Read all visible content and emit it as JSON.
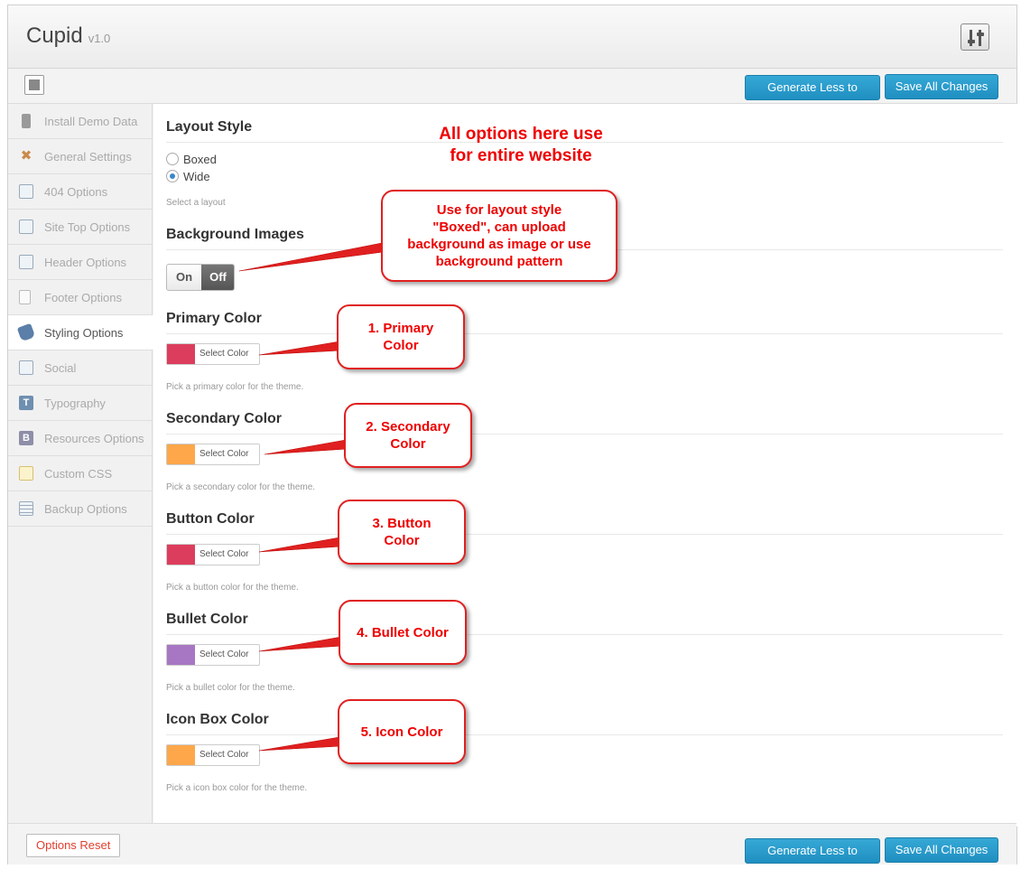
{
  "app": {
    "title": "Cupid",
    "version": "v1.0"
  },
  "toolbar": {
    "generate_label": "Generate Less to CSS",
    "save_label": "Save All Changes"
  },
  "sidebar": {
    "items": [
      {
        "label": "Install Demo Data",
        "icon": "install-icon"
      },
      {
        "label": "General Settings",
        "icon": "tools-icon"
      },
      {
        "label": "404 Options",
        "icon": "window-icon"
      },
      {
        "label": "Site Top Options",
        "icon": "window-icon"
      },
      {
        "label": "Header Options",
        "icon": "window-icon"
      },
      {
        "label": "Footer Options",
        "icon": "page-icon"
      },
      {
        "label": "Styling Options",
        "icon": "paint-bucket-icon",
        "active": true
      },
      {
        "label": "Social",
        "icon": "window-icon"
      },
      {
        "label": "Typography",
        "icon": "T",
        "icon_color": "#6f8fb0"
      },
      {
        "label": "Resources Options",
        "icon": "B",
        "icon_color": "#8e8ea8"
      },
      {
        "label": "Custom CSS",
        "icon": "css-icon"
      },
      {
        "label": "Backup Options",
        "icon": "backup-icon"
      }
    ]
  },
  "layout_style": {
    "title": "Layout Style",
    "options": [
      "Boxed",
      "Wide"
    ],
    "selected": "Wide",
    "description": "Select a layout"
  },
  "background_images": {
    "title": "Background Images",
    "on_label": "On",
    "off_label": "Off",
    "state": "Off"
  },
  "colors": [
    {
      "title": "Primary Color",
      "swatch": "#dd3d5d",
      "picker_label": "Select Color",
      "description": "Pick a primary color for the theme."
    },
    {
      "title": "Secondary Color",
      "swatch": "#fea74a",
      "picker_label": "Select Color",
      "description": "Pick a secondary color for the theme."
    },
    {
      "title": "Button Color",
      "swatch": "#dd3d5d",
      "picker_label": "Select Color",
      "description": "Pick a button color for the theme."
    },
    {
      "title": "Bullet Color",
      "swatch": "#a777c4",
      "picker_label": "Select Color",
      "description": "Pick a bullet color for the theme."
    },
    {
      "title": "Icon Box Color",
      "swatch": "#fea74a",
      "picker_label": "Select Color",
      "description": "Pick a icon box color for the theme."
    }
  ],
  "annotations": {
    "main_note_line1": "All options here use",
    "main_note_line2": "for entire website",
    "background_note_lines": [
      "Use for layout style",
      "\"Boxed\", can upload",
      "background as image or use",
      "background pattern"
    ],
    "primary_note_lines": [
      "1. Primary",
      "Color"
    ],
    "secondary_note_lines": [
      "2. Secondary",
      "Color"
    ],
    "button_note_lines": [
      "3. Button",
      "Color"
    ],
    "bullet_note": "4. Bullet Color",
    "icon_note": "5. Icon Color"
  },
  "footer": {
    "reset_label": "Options Reset"
  },
  "accent_colors": {
    "button_blue": "#2a9dcd",
    "annotation_red": "#e02020"
  }
}
